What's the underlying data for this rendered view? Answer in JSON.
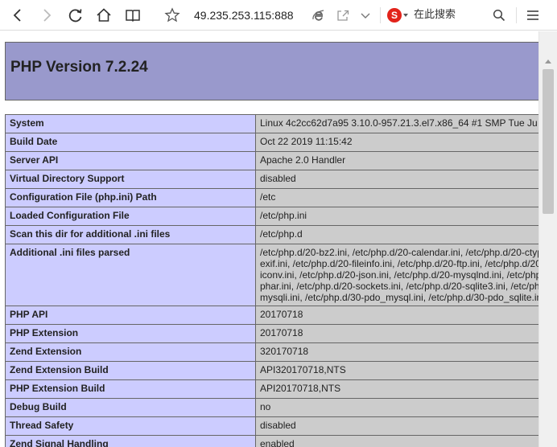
{
  "browser": {
    "url": "49.235.253.115:888",
    "search_placeholder": "在此搜索",
    "search_logo": "S"
  },
  "php": {
    "title": "PHP Version 7.2.24",
    "rows": [
      {
        "key": "System",
        "value": "Linux 4c2cc62d7a95 3.10.0-957.21.3.el7.x86_64 #1 SMP Tue Ju"
      },
      {
        "key": "Build Date",
        "value": "Oct 22 2019 11:15:42"
      },
      {
        "key": "Server API",
        "value": "Apache 2.0 Handler"
      },
      {
        "key": "Virtual Directory Support",
        "value": "disabled"
      },
      {
        "key": "Configuration File (php.ini) Path",
        "value": "/etc"
      },
      {
        "key": "Loaded Configuration File",
        "value": "/etc/php.ini"
      },
      {
        "key": "Scan this dir for additional .ini files",
        "value": "/etc/php.d"
      }
    ],
    "ini_row": {
      "key": "Additional .ini files parsed",
      "lines": [
        "/etc/php.d/20-bz2.ini, /etc/php.d/20-calendar.ini, /etc/php.d/20-ctyp",
        "exif.ini, /etc/php.d/20-fileinfo.ini, /etc/php.d/20-ftp.ini, /etc/php.d/20",
        "iconv.ini, /etc/php.d/20-json.ini, /etc/php.d/20-mysqlnd.ini, /etc/php.",
        "phar.ini, /etc/php.d/20-sockets.ini, /etc/php.d/20-sqlite3.ini, /etc/ph",
        "mysqli.ini, /etc/php.d/30-pdo_mysql.ini, /etc/php.d/30-pdo_sqlite.ini"
      ]
    },
    "rows2": [
      {
        "key": "PHP API",
        "value": "20170718"
      },
      {
        "key": "PHP Extension",
        "value": "20170718"
      },
      {
        "key": "Zend Extension",
        "value": "320170718"
      },
      {
        "key": "Zend Extension Build",
        "value": "API320170718,NTS"
      },
      {
        "key": "PHP Extension Build",
        "value": "API20170718,NTS"
      },
      {
        "key": "Debug Build",
        "value": "no"
      },
      {
        "key": "Thread Safety",
        "value": "disabled"
      },
      {
        "key": "Zend Signal Handling",
        "value": "enabled"
      }
    ]
  },
  "colors": {
    "header_bg": "#9999cc",
    "key_bg": "#ccccff",
    "value_bg": "#cccccc",
    "border": "#666666"
  }
}
